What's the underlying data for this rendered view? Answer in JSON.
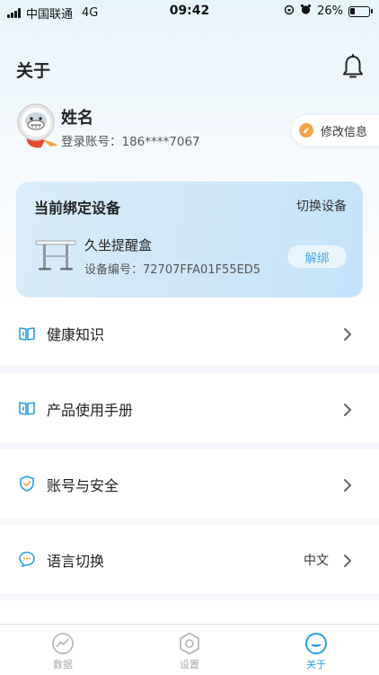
{
  "status_bar": {
    "carrier": "中国联通",
    "network": "4G",
    "time": "09:42",
    "battery": "26%",
    "battery_level": 0.26
  },
  "header": {
    "title": "关于"
  },
  "profile": {
    "name": "姓名",
    "account_label": "登录账号：",
    "account_value": "186****7067",
    "edit_label": "修改信息"
  },
  "device_card": {
    "title": "当前绑定设备",
    "switch_label": "切换设备",
    "device_name": "久坐提醒盒",
    "device_id_label": "设备编号：",
    "device_id_value": "72707FFA01F55ED5",
    "unbind_label": "解绑"
  },
  "menu": [
    {
      "label": "健康知识",
      "icon": "book-icon",
      "value": ""
    },
    {
      "label": "产品使用手册",
      "icon": "book-icon",
      "value": ""
    },
    {
      "label": "账号与安全",
      "icon": "shield-check-icon",
      "value": ""
    },
    {
      "label": "语言切换",
      "icon": "chat-bubble-icon",
      "value": "中文"
    }
  ],
  "tabs": [
    {
      "label": "数据",
      "icon": "chart-line-icon",
      "active": false
    },
    {
      "label": "设置",
      "icon": "gear-icon",
      "active": false
    },
    {
      "label": "关于",
      "icon": "compass-icon",
      "active": true
    }
  ],
  "colors": {
    "accent": "#2b9fe0",
    "edit_icon": "#f3a447",
    "card_bg": "#d3e9f9",
    "unbind_text": "#4aa8e3"
  }
}
